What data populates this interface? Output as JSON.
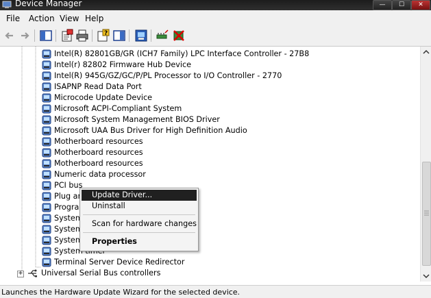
{
  "window": {
    "title": "Device Manager",
    "controls": [
      "—",
      "☐",
      "✕"
    ]
  },
  "menu": [
    "File",
    "Action",
    "View",
    "Help"
  ],
  "toolbar": {
    "icons": [
      "back-arrow-icon",
      "forward-arrow-icon",
      "show-hide-tree-icon",
      "properties-icon",
      "print-icon",
      "help-icon",
      "console-tree-icon",
      "update-driver-icon",
      "scan-hardware-icon",
      "uninstall-icon"
    ]
  },
  "tree": {
    "devices": [
      "Intel(R) 82801GB/GR (ICH7 Family) LPC Interface Controller - 27B8",
      "Intel(r) 82802 Firmware Hub Device",
      "Intel(R) 945G/GZ/GC/P/PL Processor to I/O Controller - 2770",
      "ISAPNP Read Data Port",
      "Microcode Update Device",
      "Microsoft ACPI-Compliant System",
      "Microsoft System Management BIOS Driver",
      "Microsoft UAA Bus Driver for High Definition Audio",
      "Motherboard resources",
      "Motherboard resources",
      "Motherboard resources",
      "Numeric data processor",
      "PCI bus",
      "Plug an",
      "Program",
      "System",
      "System",
      "System",
      "System timer",
      "Terminal Server Device Redirector"
    ],
    "category": {
      "expander": "+",
      "label": "Universal Serial Bus controllers"
    }
  },
  "context_menu": {
    "update_driver": "Update Driver...",
    "uninstall": "Uninstall",
    "scan": "Scan for hardware changes",
    "properties": "Properties"
  },
  "status": "Launches the Hardware Update Wizard for the selected device."
}
